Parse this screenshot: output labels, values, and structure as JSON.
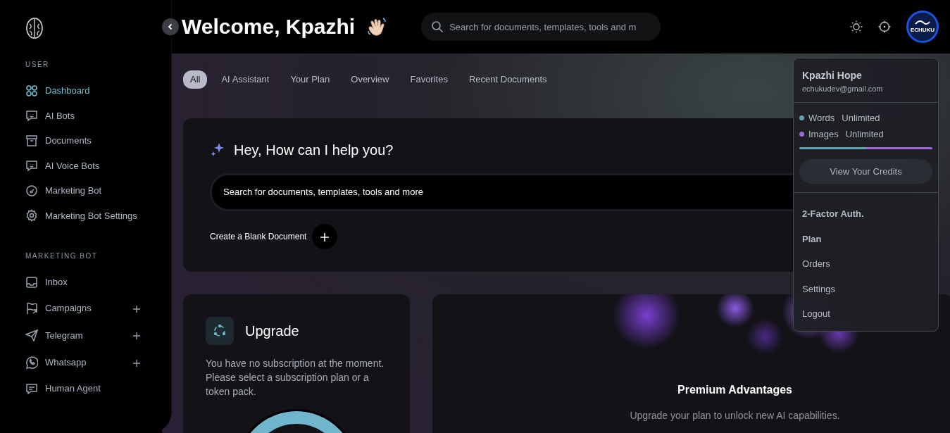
{
  "sidebar": {
    "sections": [
      {
        "title": "USER",
        "items": [
          {
            "label": "Dashboard",
            "selected": true,
            "expandable": false
          },
          {
            "label": "AI Bots",
            "selected": false,
            "expandable": false
          },
          {
            "label": "Documents",
            "selected": false,
            "expandable": false
          },
          {
            "label": "AI Voice Bots",
            "selected": false,
            "expandable": false
          },
          {
            "label": "Marketing Bot",
            "selected": false,
            "expandable": false
          },
          {
            "label": "Marketing Bot Settings",
            "selected": false,
            "expandable": false
          }
        ]
      },
      {
        "title": "MARKETING BOT",
        "items": [
          {
            "label": "Inbox",
            "selected": false,
            "expandable": false
          },
          {
            "label": "Campaigns",
            "selected": false,
            "expandable": true
          },
          {
            "label": "Telegram",
            "selected": false,
            "expandable": true
          },
          {
            "label": "Whatsapp",
            "selected": false,
            "expandable": true
          },
          {
            "label": "Human Agent",
            "selected": false,
            "expandable": false
          }
        ]
      }
    ]
  },
  "header": {
    "greeting": "Welcome, Kpazhi",
    "search": {
      "placeholder": "Search for documents, templates, tools and m"
    },
    "avatar": "ECHUKU"
  },
  "tabs": [
    {
      "label": "All",
      "selected": true
    },
    {
      "label": "AI Assistant",
      "selected": false
    },
    {
      "label": "Your Plan",
      "selected": false
    },
    {
      "label": "Overview",
      "selected": false
    },
    {
      "label": "Favorites",
      "selected": false
    },
    {
      "label": "Recent Documents",
      "selected": false
    }
  ],
  "hero": {
    "title": "Hey, How can I help you?",
    "search": {
      "placeholder": "Search for documents, templates, tools and more"
    },
    "create_label": "Create a Blank Document"
  },
  "upgrade": {
    "title": "Upgrade",
    "text": "You have no subscription at the moment. Please select a subscription plan or a token pack."
  },
  "premium": {
    "title": "Premium Advantages",
    "text": "Upgrade your plan to unlock new AI capabilities."
  },
  "user_menu": {
    "name": "Kpazhi Hope",
    "email": "echukudev@gmail.com",
    "credits": [
      {
        "label": "Words",
        "value": "Unlimited",
        "color": "#5ea3b5"
      },
      {
        "label": "Images",
        "value": "Unlimited",
        "color": "#a066e0"
      }
    ],
    "credits_button": "View Your Credits",
    "items": [
      "2-Factor Auth.",
      "Plan",
      "Orders",
      "Settings",
      "Logout"
    ]
  }
}
